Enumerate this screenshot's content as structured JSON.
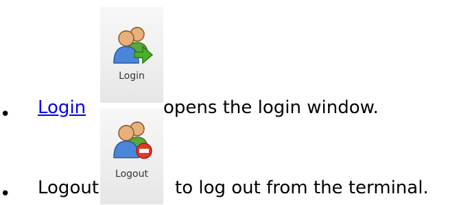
{
  "items": [
    {
      "link_label": "Login",
      "button_label": "Login",
      "description": "opens the login window."
    },
    {
      "label": "Logout",
      "button_label": "Logout",
      "description": "to log out from the terminal."
    }
  ],
  "colors": {
    "link": "#0000ee",
    "head_skin": "#e8b07a",
    "hair": "#7a4a1c",
    "shirt_blue": "#4a86d8",
    "shirt_green": "#5aa83a",
    "arrow_green": "#4caf28",
    "stop_red": "#e03a2a"
  },
  "icons": {
    "login": "users-arrow-icon",
    "logout": "users-remove-icon"
  }
}
